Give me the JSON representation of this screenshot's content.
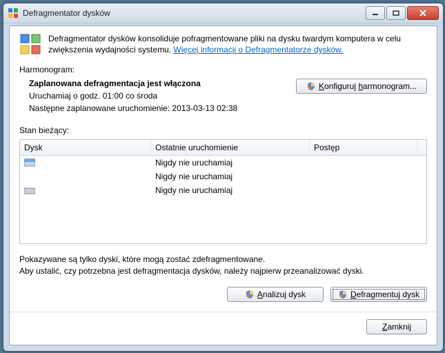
{
  "window": {
    "title": "Defragmentator dysków"
  },
  "intro": {
    "text": "Defragmentator dysków konsoliduje pofragmentowane pliki na dysku twardym komputera w celu zwiększenia wydajności systemu. ",
    "link": "Więcej informacji o Defragmentatorze dysków."
  },
  "schedule": {
    "label": "Harmonogram:",
    "status": "Zaplanowana defragmentacja jest włączona",
    "run_line": "Uruchamiaj o godz. 01:00 co środa",
    "next_line": "Następne zaplanowane uruchomienie: 2013-03-13 02:38",
    "config_btn": "Konfiguruj harmonogram..."
  },
  "current": {
    "label": "Stan bieżący:",
    "columns": {
      "disk": "Dysk",
      "last": "Ostatnie uruchomienie",
      "progress": "Postęp"
    },
    "rows": [
      {
        "name": "",
        "last": "Nigdy nie uruchamiaj",
        "progress": ""
      },
      {
        "name": "",
        "last": "Nigdy nie uruchamiaj",
        "progress": ""
      },
      {
        "name": "",
        "last": "Nigdy nie uruchamiaj",
        "progress": ""
      }
    ]
  },
  "note": {
    "line1": "Pokazywane są tylko dyski, które mogą zostać zdefragmentowane.",
    "line2": "Aby ustalić, czy potrzebna jest defragmentacja dysków, należy najpierw przeanalizować dyski."
  },
  "actions": {
    "analyze": "Analizuj dysk",
    "defrag": "Defragmentuj dysk",
    "close": "Zamknij"
  }
}
